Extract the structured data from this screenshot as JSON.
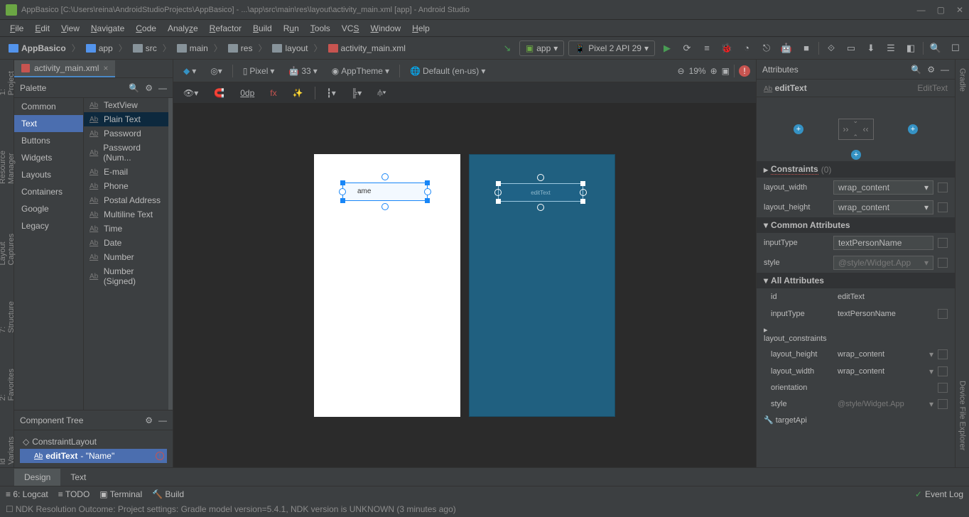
{
  "window": {
    "title": "AppBasico [C:\\Users\\reina\\AndroidStudioProjects\\AppBasico] - ...\\app\\src\\main\\res\\layout\\activity_main.xml [app] - Android Studio"
  },
  "menu": [
    "File",
    "Edit",
    "View",
    "Navigate",
    "Code",
    "Analyze",
    "Refactor",
    "Build",
    "Run",
    "Tools",
    "VCS",
    "Window",
    "Help"
  ],
  "breadcrumb": [
    "AppBasico",
    "app",
    "src",
    "main",
    "res",
    "layout",
    "activity_main.xml"
  ],
  "run_config": {
    "app": "app",
    "device": "Pixel 2 API 29"
  },
  "file_tab": "activity_main.xml",
  "leftside_tabs": [
    "1: Project",
    "Resource Manager",
    "Layout Captures",
    "7: Structure",
    "2: Favorites",
    "ld Variants"
  ],
  "rightside_tabs": [
    "Gradle",
    "Device File Explorer"
  ],
  "palette": {
    "title": "Palette",
    "categories": [
      "Common",
      "Text",
      "Buttons",
      "Widgets",
      "Layouts",
      "Containers",
      "Google",
      "Legacy"
    ],
    "selected_category": "Text",
    "items": [
      "TextView",
      "Plain Text",
      "Password",
      "Password (Num...",
      "E-mail",
      "Phone",
      "Postal Address",
      "Multiline Text",
      "Time",
      "Date",
      "Number",
      "Number (Signed)"
    ],
    "selected_item": "Plain Text"
  },
  "component_tree": {
    "title": "Component Tree",
    "root": "ConstraintLayout",
    "child_id": "editText",
    "child_text": "- \"Name\""
  },
  "canvas_toolbar": {
    "device": "Pixel",
    "api": "33",
    "theme": "AppTheme",
    "locale": "Default (en-us)",
    "zoom": "19%",
    "margin": "0dp"
  },
  "design_preview": {
    "edittext_text": "ame"
  },
  "blueprint_preview": {
    "edittext_text": "editText"
  },
  "attributes": {
    "title": "Attributes",
    "id_label": "editText",
    "type": "EditText",
    "constraints_title": "Constraints",
    "constraints_count": "(0)",
    "layout_width": "wrap_content",
    "layout_height": "wrap_content",
    "common_title": "Common Attributes",
    "inputType": "textPersonName",
    "style": "@style/Widget.App",
    "all_title": "All Attributes",
    "all": {
      "id": "editText",
      "inputType": "textPersonName",
      "layout_constraints": "layout_constraints",
      "layout_height": "wrap_content",
      "layout_width": "wrap_content",
      "orientation": "",
      "style": "@style/Widget.App",
      "targetApi": "targetApi"
    }
  },
  "bottom_tabs": {
    "design": "Design",
    "text": "Text"
  },
  "statusbar": {
    "logcat": "6: Logcat",
    "todo": "TODO",
    "terminal": "Terminal",
    "build": "Build",
    "eventlog": "Event Log"
  },
  "message": "NDK Resolution Outcome: Project settings: Gradle model version=5.4.1, NDK version is UNKNOWN (3 minutes ago)"
}
